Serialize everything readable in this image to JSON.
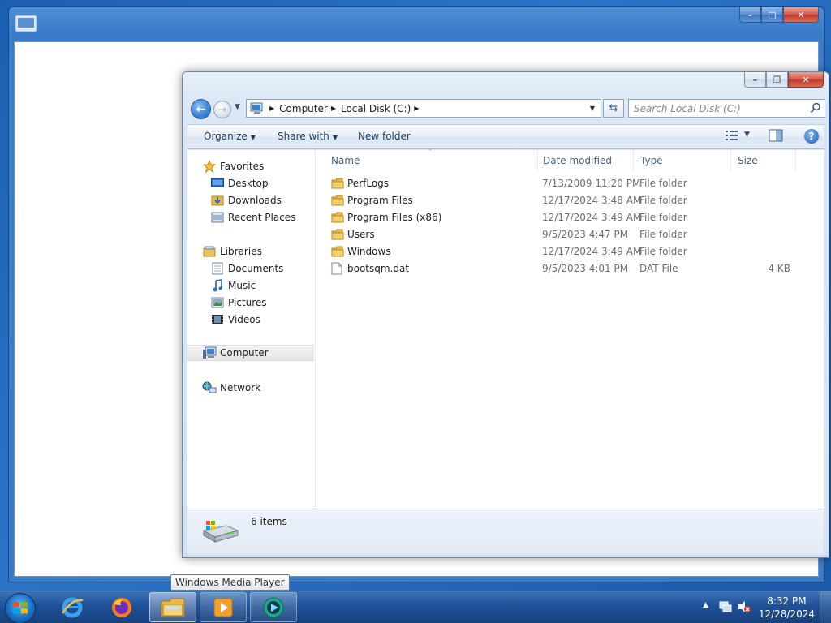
{
  "explorer": {
    "address": {
      "crumbs": [
        "Computer",
        "Local Disk (C:)"
      ]
    },
    "search": {
      "placeholder": "Search Local Disk (C:)"
    },
    "commands": {
      "organize": "Organize",
      "share_with": "Share with",
      "new_folder": "New folder"
    },
    "nav_pane": {
      "favorites": "Favorites",
      "desktop": "Desktop",
      "downloads": "Downloads",
      "recent_places": "Recent Places",
      "libraries": "Libraries",
      "documents": "Documents",
      "music": "Music",
      "pictures": "Pictures",
      "videos": "Videos",
      "computer": "Computer",
      "network": "Network"
    },
    "columns": {
      "name": "Name",
      "date_modified": "Date modified",
      "type": "Type",
      "size": "Size"
    },
    "files": [
      {
        "name": "PerfLogs",
        "date": "7/13/2009 11:20 PM",
        "type": "File folder",
        "size": "",
        "icon": "folder-icon"
      },
      {
        "name": "Program Files",
        "date": "12/17/2024 3:48 AM",
        "type": "File folder",
        "size": "",
        "icon": "folder-icon"
      },
      {
        "name": "Program Files (x86)",
        "date": "12/17/2024 3:49 AM",
        "type": "File folder",
        "size": "",
        "icon": "folder-icon"
      },
      {
        "name": "Users",
        "date": "9/5/2023 4:47 PM",
        "type": "File folder",
        "size": "",
        "icon": "folder-icon"
      },
      {
        "name": "Windows",
        "date": "12/17/2024 3:49 AM",
        "type": "File folder",
        "size": "",
        "icon": "folder-icon"
      },
      {
        "name": "bootsqm.dat",
        "date": "9/5/2023 4:01 PM",
        "type": "DAT File",
        "size": "4 KB",
        "icon": "file-icon"
      }
    ],
    "status": {
      "item_count": "6 items"
    }
  },
  "tooltip": {
    "text": "Windows Media Player"
  },
  "taskbar": {
    "apps": [
      "internet-explorer-icon",
      "firefox-icon",
      "windows-explorer-icon",
      "media-center-icon",
      "windows-media-player-icon"
    ],
    "clock": {
      "time": "8:32 PM",
      "date": "12/28/2024"
    }
  },
  "colors": {
    "taskbar": "#1f5198",
    "folder": "#e8b84a",
    "accent": "#1f5fb5"
  }
}
